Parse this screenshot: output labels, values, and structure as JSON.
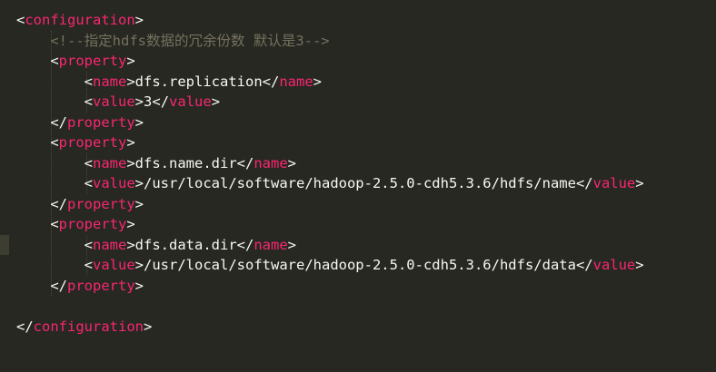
{
  "editor": {
    "colors": {
      "background": "#272822",
      "tag": "#f92672",
      "text": "#f8f8f2",
      "comment": "#75715e"
    },
    "lines": [
      {
        "indent": 0,
        "kind": "open",
        "tag": "configuration"
      },
      {
        "indent": 1,
        "kind": "comment",
        "text": "<!--指定hdfs数据的冗余份数 默认是3-->"
      },
      {
        "indent": 1,
        "kind": "open",
        "tag": "property"
      },
      {
        "indent": 2,
        "kind": "element",
        "tag": "name",
        "value": "dfs.replication"
      },
      {
        "indent": 2,
        "kind": "element",
        "tag": "value",
        "value": "3"
      },
      {
        "indent": 1,
        "kind": "close",
        "tag": "property"
      },
      {
        "indent": 1,
        "kind": "open",
        "tag": "property"
      },
      {
        "indent": 2,
        "kind": "element",
        "tag": "name",
        "value": "dfs.name.dir"
      },
      {
        "indent": 2,
        "kind": "element",
        "tag": "value",
        "value": "/usr/local/software/hadoop-2.5.0-cdh5.3.6/hdfs/name"
      },
      {
        "indent": 1,
        "kind": "close",
        "tag": "property"
      },
      {
        "indent": 1,
        "kind": "open",
        "tag": "property"
      },
      {
        "indent": 2,
        "kind": "element",
        "tag": "name",
        "value": "dfs.data.dir"
      },
      {
        "indent": 2,
        "kind": "element",
        "tag": "value",
        "value": "/usr/local/software/hadoop-2.5.0-cdh5.3.6/hdfs/data"
      },
      {
        "indent": 1,
        "kind": "close",
        "tag": "property"
      },
      {
        "indent": 0,
        "kind": "blank"
      },
      {
        "indent": 0,
        "kind": "close",
        "tag": "configuration"
      }
    ]
  }
}
